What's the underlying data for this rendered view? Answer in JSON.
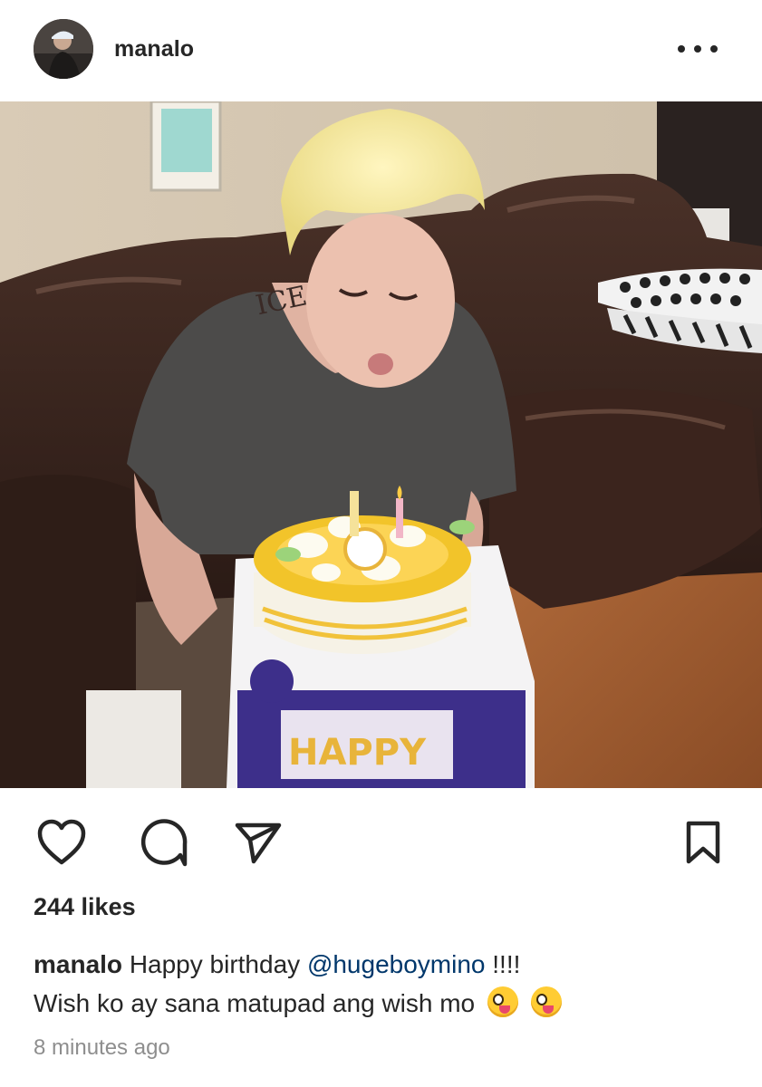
{
  "header": {
    "username": "manalo",
    "more_icon": "more-horizontal-icon"
  },
  "post": {
    "image_description_icon": "photo-image"
  },
  "actions": {
    "like_icon": "heart-icon",
    "comment_icon": "comment-icon",
    "share_icon": "send-icon",
    "save_icon": "bookmark-icon"
  },
  "likes": {
    "text": "244 likes"
  },
  "caption": {
    "username": "manalo",
    "text_before_mention": "Happy birthday",
    "mention": "@hugeboymino",
    "text_after_mention": "!!!!",
    "second_line": "Wish ko ay sana matupad ang wish mo",
    "emoji_1": "zany-face-emoji",
    "emoji_2": "zany-face-emoji"
  },
  "timestamp": "8 minutes ago",
  "colors": {
    "text": "#262626",
    "mention": "#00376b",
    "muted": "#8e8e8e",
    "background": "#ffffff"
  }
}
